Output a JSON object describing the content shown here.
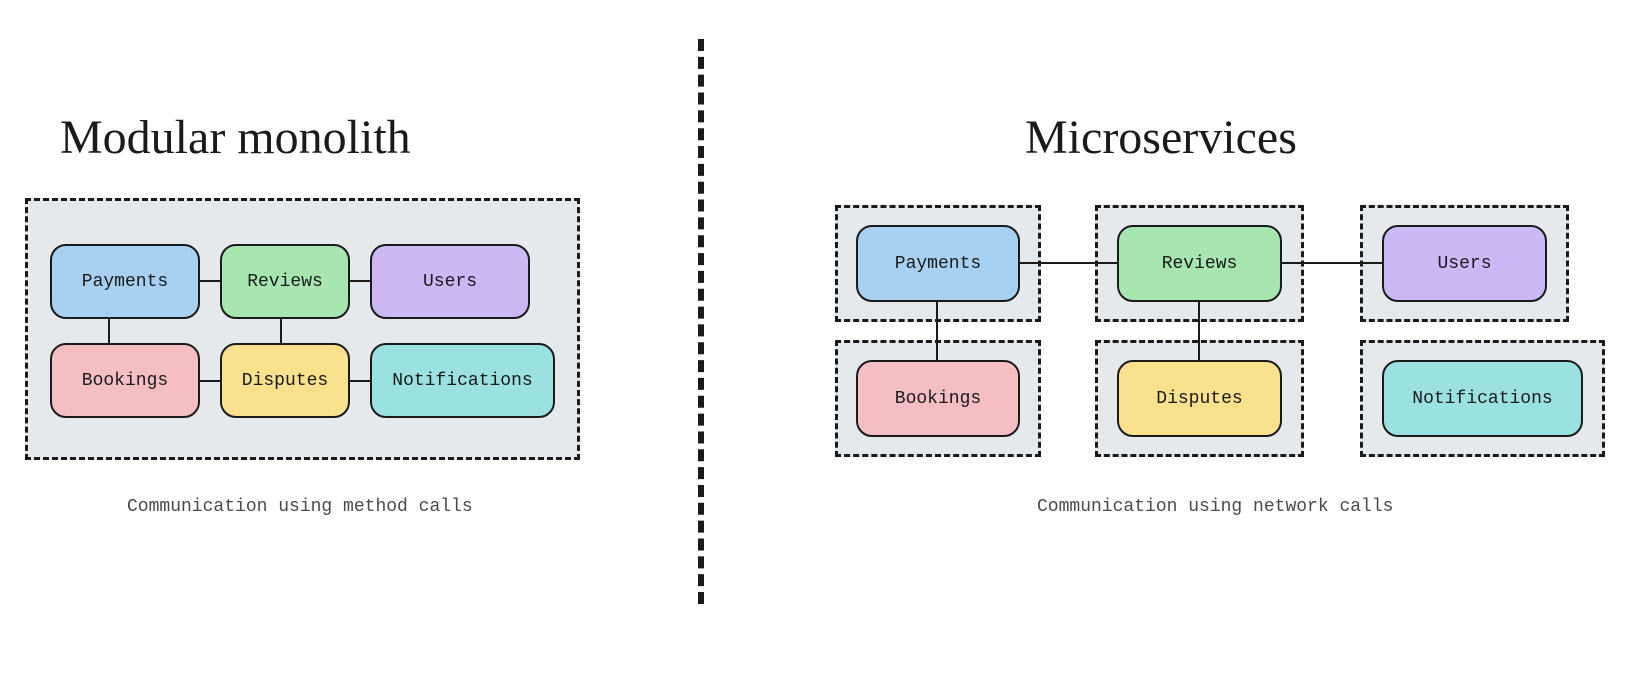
{
  "left": {
    "title": "Modular monolith",
    "caption": "Communication using method calls",
    "modules": {
      "payments": "Payments",
      "reviews": "Reviews",
      "users": "Users",
      "bookings": "Bookings",
      "disputes": "Disputes",
      "notifications": "Notifications"
    }
  },
  "right": {
    "title": "Microservices",
    "caption": "Communication using network calls",
    "modules": {
      "payments": "Payments",
      "reviews": "Reviews",
      "users": "Users",
      "bookings": "Bookings",
      "disputes": "Disputes",
      "notifications": "Notifications"
    }
  },
  "colors": {
    "payments": "#a8d0f0",
    "reviews": "#a7e6b1",
    "users": "#cbb8f5",
    "bookings": "#f4bec2",
    "disputes": "#f9e18e",
    "notifications": "#9be1e2",
    "container_bg": "#e6e9ec",
    "border": "#1a1a1a"
  }
}
